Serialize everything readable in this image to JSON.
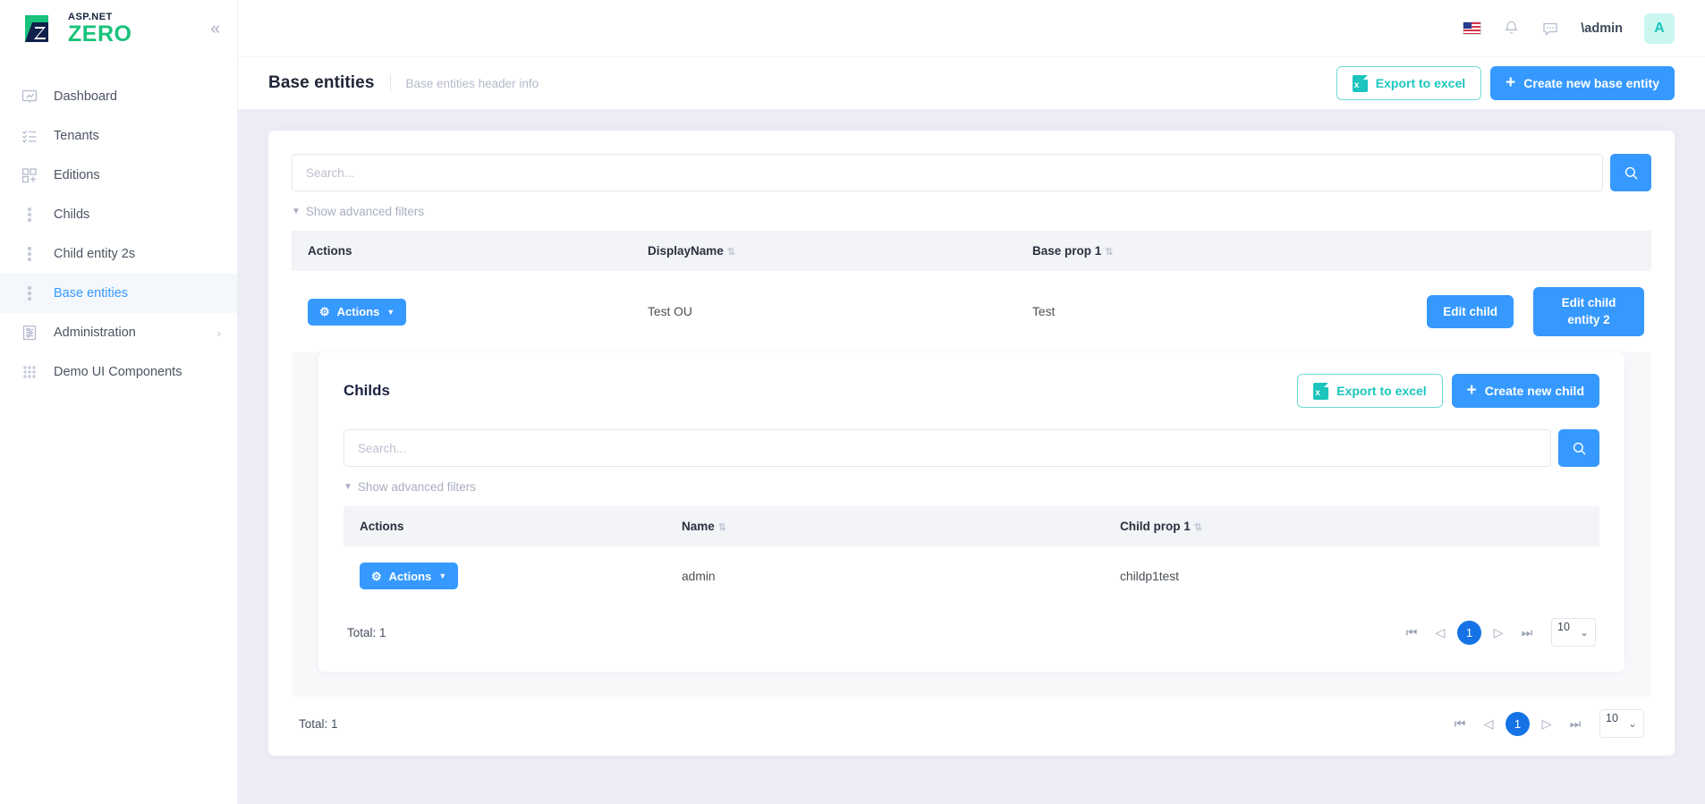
{
  "brand": {
    "top": "ASP.NET",
    "bottom": "ZERO",
    "collapse_icon": "chevrons-left-icon"
  },
  "sidebar": {
    "items": [
      {
        "label": "Dashboard",
        "icon": "dashboard-icon",
        "active": false,
        "has_caret": false
      },
      {
        "label": "Tenants",
        "icon": "tenants-icon",
        "active": false,
        "has_caret": false
      },
      {
        "label": "Editions",
        "icon": "editions-icon",
        "active": false,
        "has_caret": false
      },
      {
        "label": "Childs",
        "icon": "dots-icon",
        "active": false,
        "has_caret": false
      },
      {
        "label": "Child entity 2s",
        "icon": "dots-icon",
        "active": false,
        "has_caret": false
      },
      {
        "label": "Base entities",
        "icon": "dots-icon",
        "active": true,
        "has_caret": false
      },
      {
        "label": "Administration",
        "icon": "administration-icon",
        "active": false,
        "has_caret": true
      },
      {
        "label": "Demo UI Components",
        "icon": "grid-icon",
        "active": false,
        "has_caret": false
      }
    ]
  },
  "topbar": {
    "language_icon": "us-flag-icon",
    "notifications_icon": "bell-icon",
    "chat_icon": "chat-icon",
    "user_name": "\\admin",
    "avatar_initial": "A"
  },
  "subheader": {
    "title": "Base entities",
    "subtitle": "Base entities header info",
    "export_label": "Export to excel",
    "create_label": "Create new base entity"
  },
  "base_entities": {
    "search_placeholder": "Search...",
    "search_value": "",
    "advanced_filters_label": "Show advanced filters",
    "columns": [
      "Actions",
      "DisplayName",
      "Base prop 1"
    ],
    "rows": [
      {
        "actions_label": "Actions",
        "display_name": "Test OU",
        "base_prop_1": "Test",
        "edit_child_label": "Edit child",
        "edit_child_entity2_line1": "Edit child",
        "edit_child_entity2_line2": "entity 2"
      }
    ],
    "total_label": "Total: 1",
    "page_current": "1",
    "page_size": "10"
  },
  "childs": {
    "title": "Childs",
    "export_label": "Export to excel",
    "create_label": "Create new child",
    "search_placeholder": "Search...",
    "search_value": "",
    "advanced_filters_label": "Show advanced filters",
    "columns": [
      "Actions",
      "Name",
      "Child prop 1"
    ],
    "rows": [
      {
        "actions_label": "Actions",
        "name": "admin",
        "child_prop_1": "childp1test"
      }
    ],
    "total_label": "Total: 1",
    "page_current": "1",
    "page_size": "10"
  },
  "colors": {
    "primary": "#3699ff",
    "teal": "#1bc5bd",
    "brand_green": "#19c27a",
    "page_bg": "#edeef5",
    "active_page": "#1673e6"
  }
}
